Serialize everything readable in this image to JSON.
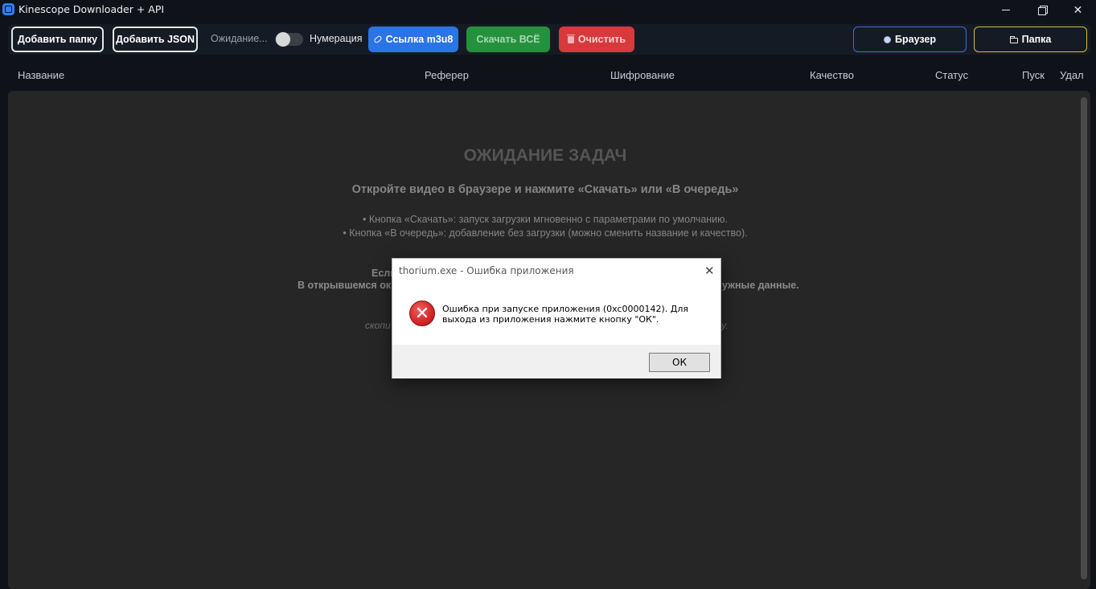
{
  "window": {
    "title": "Kinescope Downloader + API"
  },
  "toolbar": {
    "add_folder": "Добавить папку",
    "add_json": "Добавить JSON",
    "status": "Ожидание...",
    "numbering": "Нумерация",
    "numbering_on": false,
    "m3u8_link": "Ссылка m3u8",
    "download_all": "Скачать ВСЁ",
    "clear": "Очистить",
    "browser": "Браузер",
    "folder": "Папка"
  },
  "columns": [
    "Название",
    "Реферер",
    "Шифрование",
    "Качество",
    "Статус",
    "Пуск",
    "Удал"
  ],
  "empty_state": {
    "title": "ОЖИДАНИЕ ЗАДАЧ",
    "subtitle": "Откройте видео в браузере и нажмите «Скачать» или «В очередь»",
    "line1": "• Кнопка «Скачать»: запуск загрузки мгновенно с параметрами по умолчанию.",
    "line2": "• Кнопка «В очередь»: добавление без загрузки (можно сменить название и качество).",
    "partial_a": "Если",
    "partial_b": "В открывшемся окне",
    "partial_c": "ужные данные.",
    "partial_d": "скопи",
    "partial_e": "у."
  },
  "dialog": {
    "title": "thorium.exe - Ошибка приложения",
    "message": "Ошибка при запуске приложения (0xc0000142). Для выхода из приложения нажмите кнопку \"ОК\".",
    "ok": "ОК"
  },
  "colors": {
    "m3u8": "#2b74e6",
    "download_all": "#25913c",
    "clear": "#d8393c",
    "browser_border": "#3a6fd8",
    "folder_border": "#d9b934"
  }
}
